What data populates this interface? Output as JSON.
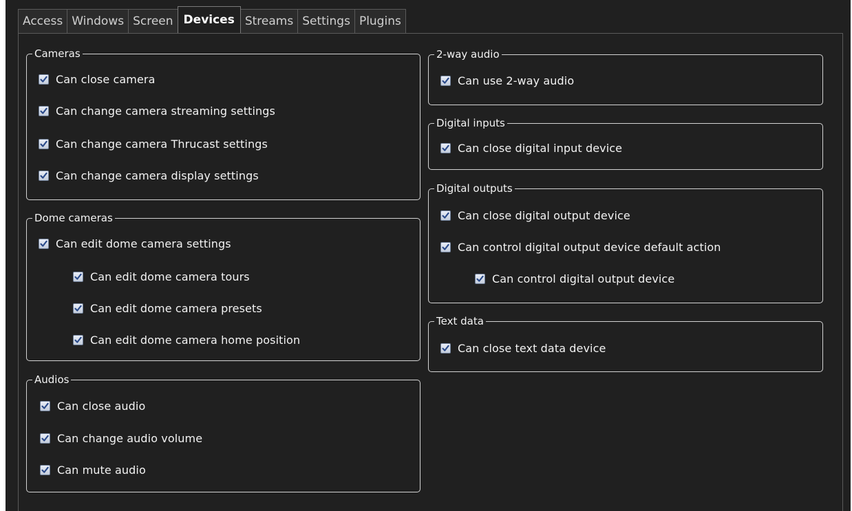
{
  "tabs": [
    {
      "label": "Access"
    },
    {
      "label": "Windows"
    },
    {
      "label": "Screen"
    },
    {
      "label": "Devices",
      "active": true
    },
    {
      "label": "Streams"
    },
    {
      "label": "Settings"
    },
    {
      "label": "Plugins"
    }
  ],
  "groups": {
    "cameras": {
      "title": "Cameras",
      "items": [
        {
          "label": "Can close camera",
          "checked": true
        },
        {
          "label": "Can change camera streaming settings",
          "checked": true
        },
        {
          "label": "Can change camera Thrucast settings",
          "checked": true
        },
        {
          "label": "Can change camera display settings",
          "checked": true
        }
      ]
    },
    "dome_cameras": {
      "title": "Dome cameras",
      "items": [
        {
          "label": "Can edit dome camera settings",
          "checked": true
        },
        {
          "label": "Can edit dome camera tours",
          "checked": true
        },
        {
          "label": "Can edit dome camera presets",
          "checked": true
        },
        {
          "label": "Can edit dome camera home position",
          "checked": true
        }
      ]
    },
    "audios": {
      "title": "Audios",
      "items": [
        {
          "label": "Can close audio",
          "checked": true
        },
        {
          "label": "Can change audio volume",
          "checked": true
        },
        {
          "label": "Can mute audio",
          "checked": true
        }
      ]
    },
    "two_way_audio": {
      "title": "2-way audio",
      "items": [
        {
          "label": "Can use 2-way audio",
          "checked": true
        }
      ]
    },
    "digital_inputs": {
      "title": "Digital inputs",
      "items": [
        {
          "label": "Can close digital input device",
          "checked": true
        }
      ]
    },
    "digital_outputs": {
      "title": "Digital outputs",
      "items": [
        {
          "label": "Can close digital output device",
          "checked": true
        },
        {
          "label": "Can control digital output device default action",
          "checked": true
        },
        {
          "label": "Can control digital output device",
          "checked": true
        }
      ]
    },
    "text_data": {
      "title": "Text data",
      "items": [
        {
          "label": "Can close text data device",
          "checked": true
        }
      ]
    }
  },
  "colors": {
    "background": "#202020",
    "text": "#f2f2f2",
    "group_border": "#d4d4d4",
    "checkmark": "#2a4a8a"
  }
}
